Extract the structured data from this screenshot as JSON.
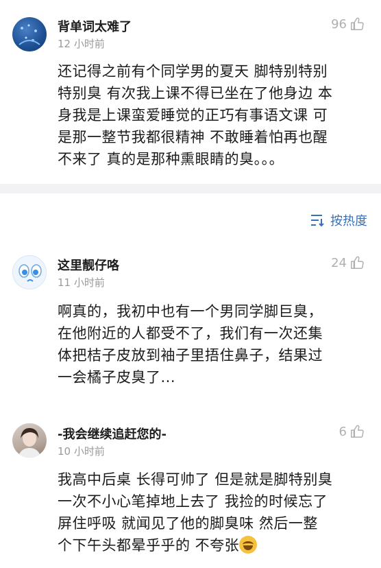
{
  "comments": [
    {
      "username": "背单词太难了",
      "time": "12 小时前",
      "likes": "96",
      "lines": [
        "还记得之前有个同学男的夏天 脚特别特别",
        "特别臭 有次我上课不得已坐在了他身边 本",
        "身我是上课蛮爱睡觉的正巧有事语文课 可",
        "是那一整节我都很精神 不敢睡着怕再也醒",
        "不来了 真的是那种熏眼睛的臭。。。"
      ]
    },
    {
      "username": "这里靓仔咯",
      "time": "11 小时前",
      "likes": "24",
      "lines": [
        "啊真的，我初中也有一个男同学脚巨臭，",
        "在他附近的人都受不了，我们有一次还集",
        "体把桔子皮放到袖子里捂住鼻子，结果过",
        "一会橘子皮臭了..."
      ]
    },
    {
      "username": "-我会继续追赶您的-",
      "time": "10 小时前",
      "likes": "6",
      "lines": [
        "我高中后桌 长得可帅了 但是就是脚特别臭",
        "一次不小心笔掉地上去了 我捡的时候忘了",
        "屏住呼吸 就闻见了他的脚臭味 然后一整",
        "个下午头都晕乎乎的 不夸张"
      ]
    }
  ],
  "sort": {
    "label": "按热度",
    "icon": "sort-icon"
  },
  "icons": {
    "like": "thumbs-up-icon",
    "emoji": "laughing-tears-emoji-icon"
  },
  "colors": {
    "sort_accent": "#3b6fb5",
    "divider": "#f2f2f4",
    "muted": "#9a9a9a"
  }
}
